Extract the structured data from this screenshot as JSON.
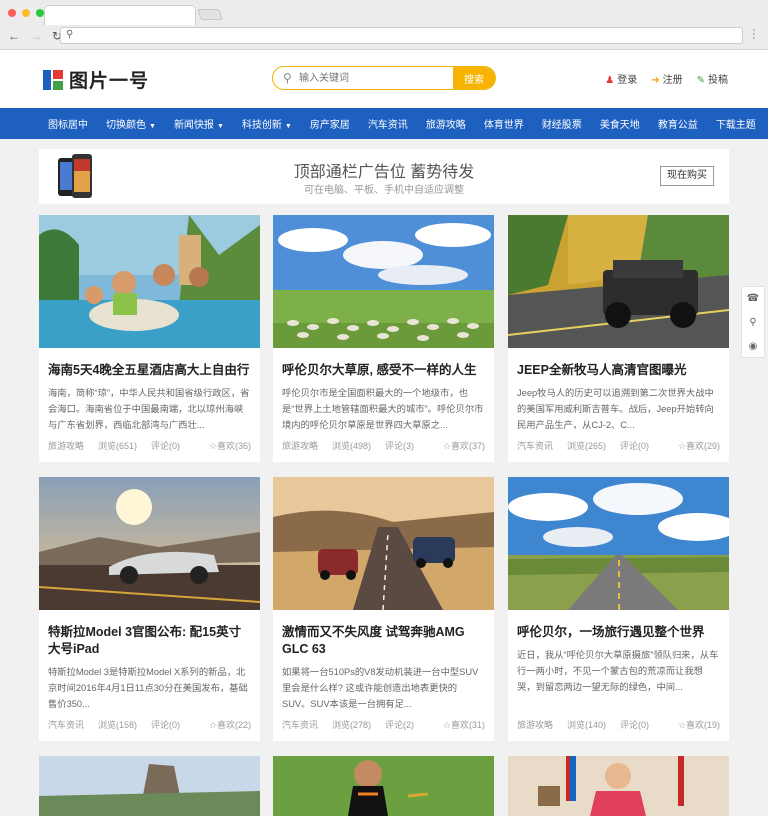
{
  "browser": {
    "url": ""
  },
  "header": {
    "logo_text": "图片一号",
    "search_placeholder": "输入关键词",
    "search_button": "搜索",
    "login": "登录",
    "register": "注册",
    "submit": "投稿"
  },
  "nav": {
    "items": [
      "图标居中",
      "切换颜色",
      "新闻快报",
      "科技创新",
      "房产家居",
      "汽车资讯",
      "旅游攻略",
      "体育世界",
      "财经股票",
      "美食天地",
      "教育公益",
      "下载主题"
    ]
  },
  "ad": {
    "title": "顶部通栏广告位  蓄势待发",
    "subtitle": "可在电脑、平板、手机中自适应调整",
    "button": "现在购买"
  },
  "cards": [
    {
      "title": "海南5天4晚全五星酒店高大上自由行",
      "desc": "海南，简称“琼”，中华人民共和国省级行政区，省会海口。海南省位于中国最南端，北以琼州海峡与广东省划界，西临北部湾与广西壮...",
      "category": "旅游攻略",
      "views": "浏览(651)",
      "comments": "评论(0)",
      "likes": "喜欢(36)"
    },
    {
      "title": "呼伦贝尔大草原, 感受不一样的人生",
      "desc": "呼伦贝尔市是全国面积最大的一个地级市，也是“世界上土地管辖面积最大的城市”。呼伦贝尔市境内的呼伦贝尔草原是世界四大草原之...",
      "category": "旅游攻略",
      "views": "浏览(498)",
      "comments": "评论(3)",
      "likes": "喜欢(37)"
    },
    {
      "title": "JEEP全新牧马人高清官图曝光",
      "desc": "Jeep牧马人的历史可以追溯到第二次世界大战中的美国军用威利斯吉普车。战后，Jeep开始转向民用产品生产，从CJ-2、C...",
      "category": "汽车资讯",
      "views": "浏览(265)",
      "comments": "评论(0)",
      "likes": "喜欢(29)"
    },
    {
      "title": "特斯拉Model 3官图公布: 配15英寸大号iPad",
      "desc": "特斯拉Model 3是特斯拉Model X系列的新品，北京时间2016年4月1日11点30分在美国发布，基础售价350...",
      "category": "汽车资讯",
      "views": "浏览(158)",
      "comments": "评论(0)",
      "likes": "喜欢(22)"
    },
    {
      "title": "激情而又不失风度 试驾奔驰AMG GLC 63",
      "desc": "如果将一台510Ps的V8发动机装进一台中型SUV里会是什么样? 这或许能创造出地表更快的SUV。SUV本该是一台拥有足...",
      "category": "汽车资讯",
      "views": "浏览(278)",
      "comments": "评论(2)",
      "likes": "喜欢(31)"
    },
    {
      "title": "呼伦贝尔，一场旅行遇见整个世界",
      "desc": "近日，我从“呼伦贝尔大草原摄旅”领队归来，从车行一两小时，不见一个蒙古包的荒凉而让我想哭，到留恋两边一望无际的绿色，中间...",
      "category": "旅游攻略",
      "views": "浏览(140)",
      "comments": "评论(0)",
      "likes": "喜欢(19)"
    }
  ],
  "colors": {
    "nav": "#1e60c0",
    "accent": "#f6b400"
  }
}
